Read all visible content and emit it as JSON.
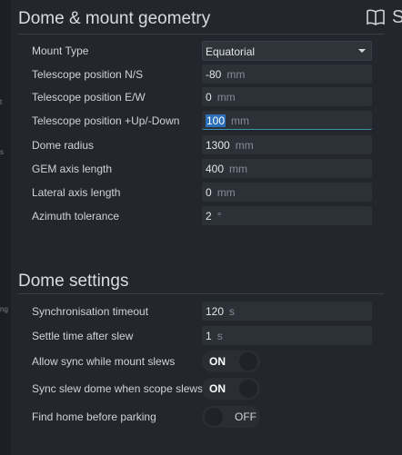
{
  "left_fragments": [
    "t",
    "s",
    "ng"
  ],
  "right_edge_letter": "S",
  "geometry": {
    "title": "Dome & mount geometry",
    "mount_type": {
      "label": "Mount Type",
      "value": "Equatorial"
    },
    "pos_ns": {
      "label": "Telescope position N/S",
      "value": "-80",
      "unit": "mm"
    },
    "pos_ew": {
      "label": "Telescope position E/W",
      "value": "0",
      "unit": "mm"
    },
    "pos_ud": {
      "label": "Telescope position +Up/-Down",
      "value": "100",
      "unit": "mm"
    },
    "dome_radius": {
      "label": "Dome radius",
      "value": "1300",
      "unit": "mm"
    },
    "gem_axis": {
      "label": "GEM axis length",
      "value": "400",
      "unit": "mm"
    },
    "lateral_axis": {
      "label": "Lateral axis length",
      "value": "0",
      "unit": "mm"
    },
    "az_tolerance": {
      "label": "Azimuth tolerance",
      "value": "2",
      "unit": "°"
    }
  },
  "settings": {
    "title": "Dome settings",
    "sync_timeout": {
      "label": "Synchronisation timeout",
      "value": "120",
      "unit": "s"
    },
    "settle_time": {
      "label": "Settle time after slew",
      "value": "1",
      "unit": "s"
    },
    "allow_sync": {
      "label": "Allow sync while mount slews",
      "state": "ON"
    },
    "sync_slew": {
      "label": "Sync slew dome when scope slews",
      "state": "ON"
    },
    "find_home": {
      "label": "Find home before parking",
      "state": "OFF"
    }
  }
}
